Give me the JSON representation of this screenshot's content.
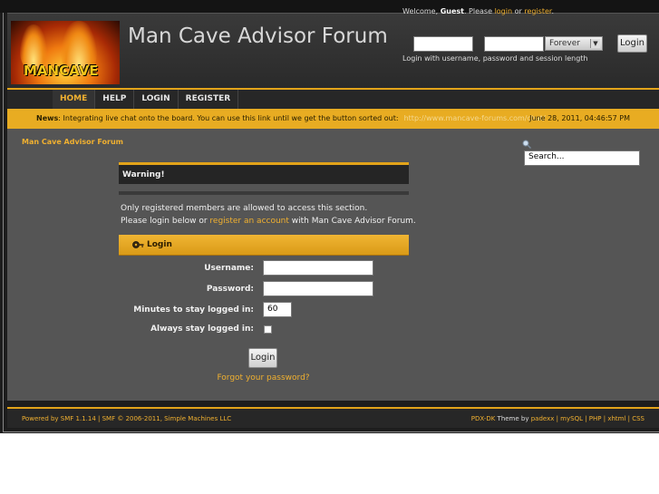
{
  "header": {
    "logo_text": "MANCAVE",
    "site_title": "Man Cave Advisor Forum",
    "welcome_prefix": "Welcome, ",
    "welcome_user": "Guest",
    "welcome_mid": ". Please ",
    "login_link": "login",
    "or_text": " or ",
    "register_link": "register",
    "welcome_end": ".",
    "duration_selected": "Forever",
    "login_button": "Login",
    "login_hint": "Login with username, password and session length"
  },
  "menu": {
    "items": [
      "HOME",
      "HELP",
      "LOGIN",
      "REGISTER"
    ]
  },
  "news": {
    "label": "News",
    "text": ": Integrating live chat onto the board.  You can use this link until we get the button sorted out:",
    "url": "http://www.mancave-forums.com/chat/",
    "date": "June 28, 2011, 04:46:57 PM"
  },
  "content": {
    "breadcrumb": "Man Cave Advisor Forum",
    "search_value": "Search...",
    "warning_title": "Warning!",
    "warning_line1": "Only registered members are allowed to access this section.",
    "warning_line2_a": "Please login below or ",
    "warning_line2_link": "register an account",
    "warning_line2_b": " with Man Cave Advisor Forum.",
    "login_title": "Login",
    "username_label": "Username:",
    "password_label": "Password:",
    "minutes_label": "Minutes to stay logged in:",
    "minutes_value": "60",
    "always_label": "Always stay logged in:",
    "login_button": "Login",
    "forgot_link": "Forgot your password?"
  },
  "footer": {
    "left": "Powered by SMF 1.1.14 | SMF © 2006-2011, Simple Machines LLC",
    "right_theme": "PDX-DK",
    "right_theme_by": " Theme by ",
    "right_author": "padexx",
    "right_links": " | mySQL | PHP | xhtml | CSS"
  },
  "colors": {
    "accent": "#e3a41a",
    "link": "#f0b030",
    "content_bg": "#555555"
  }
}
